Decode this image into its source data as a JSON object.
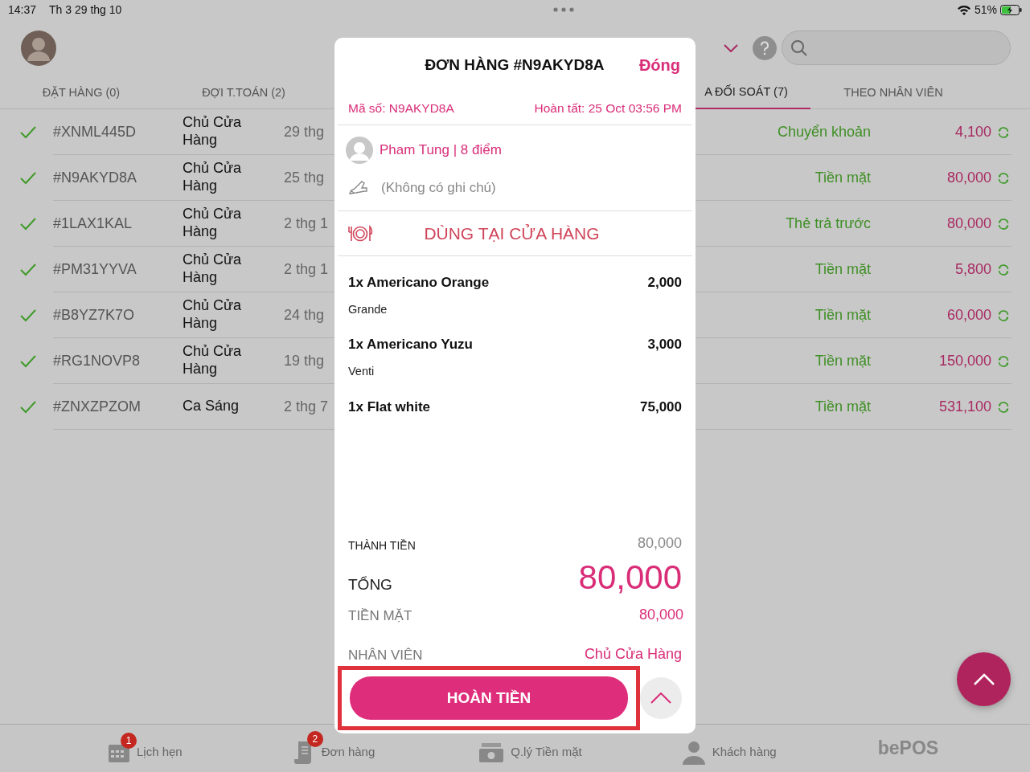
{
  "status_bar": {
    "time": "14:37",
    "date": "Th 3 29 thg 10",
    "battery": "51%"
  },
  "tabs": [
    {
      "label": "ĐẶT HÀNG (0)",
      "selected": false
    },
    {
      "label": "ĐỢI T.TOÁN (2)",
      "selected": false
    },
    {
      "label": "A ĐỐI SOÁT (7)",
      "selected": true
    },
    {
      "label": "THEO NHÂN VIÊN",
      "selected": false
    }
  ],
  "orders": [
    {
      "done": true,
      "id": "#XNML445D",
      "staff": "Chủ Cửa Hàng",
      "date": "29 thg",
      "payment": "Chuyển khoản",
      "amount": "4,100"
    },
    {
      "done": true,
      "id": "#N9AKYD8A",
      "staff": "Chủ Cửa Hàng",
      "date": "25 thg",
      "payment": "Tiền mặt",
      "amount": "80,000"
    },
    {
      "done": true,
      "id": "#1LAX1KAL",
      "staff": "Chủ Cửa Hàng",
      "date": "2 thg 1",
      "payment": "Thẻ trả trước",
      "amount": "80,000"
    },
    {
      "done": true,
      "id": "#PM31YYVA",
      "staff": "Chủ Cửa Hàng",
      "date": "2 thg 1",
      "payment": "Tiền mặt",
      "amount": "5,800"
    },
    {
      "done": true,
      "id": "#B8YZ7K7O",
      "staff": "Chủ Cửa Hàng",
      "date": "24 thg",
      "payment": "Tiền mặt",
      "amount": "60,000"
    },
    {
      "done": true,
      "id": "#RG1NOVP8",
      "staff": "Chủ Cửa Hàng",
      "date": "19 thg",
      "payment": "Tiền mặt",
      "amount": "150,000"
    },
    {
      "done": true,
      "id": "#ZNXZPZOM",
      "staff": "Ca Sáng",
      "date": "2 thg 7",
      "payment": "Tiền mặt",
      "amount": "531,100"
    }
  ],
  "modal": {
    "title": "ĐƠN HÀNG #N9AKYD8A",
    "close": "Đóng",
    "code": "Mã số: N9AKYD8A",
    "completed": "Hoàn tất: 25 Oct 03:56 PM",
    "customer": "Pham Tung | 8 điểm",
    "note": "(Không có ghi chú)",
    "service": "DÙNG TẠI CỬA HÀNG",
    "items": [
      {
        "name": "1x Americano Orange",
        "price": "2,000",
        "option": "Grande"
      },
      {
        "name": "1x Americano Yuzu",
        "price": "3,000",
        "option": "Venti"
      },
      {
        "name": "1x Flat white",
        "price": "75,000"
      }
    ],
    "totals": [
      {
        "kind": "subtotal",
        "label": "THÀNH TIỀN",
        "value": "80,000"
      },
      {
        "kind": "total",
        "label": "TỔNG",
        "value": "80,000"
      },
      {
        "kind": "payment",
        "label": "TIỀN MẶT",
        "value": "80,000"
      },
      {
        "kind": "staff",
        "label": "NHÂN VIÊN",
        "value": "Chủ Cửa Hàng"
      }
    ],
    "refund_button": "HOÀN TIỀN"
  },
  "bottom_nav": [
    {
      "kind": "calendar",
      "label": "Lịch hẹn",
      "badge": "1"
    },
    {
      "kind": "receipt",
      "label": "Đơn hàng",
      "badge": "2"
    },
    {
      "kind": "cash",
      "label": "Q.lý Tiền mặt"
    },
    {
      "kind": "person",
      "label": "Khách hàng"
    }
  ],
  "brand": "bePOS"
}
